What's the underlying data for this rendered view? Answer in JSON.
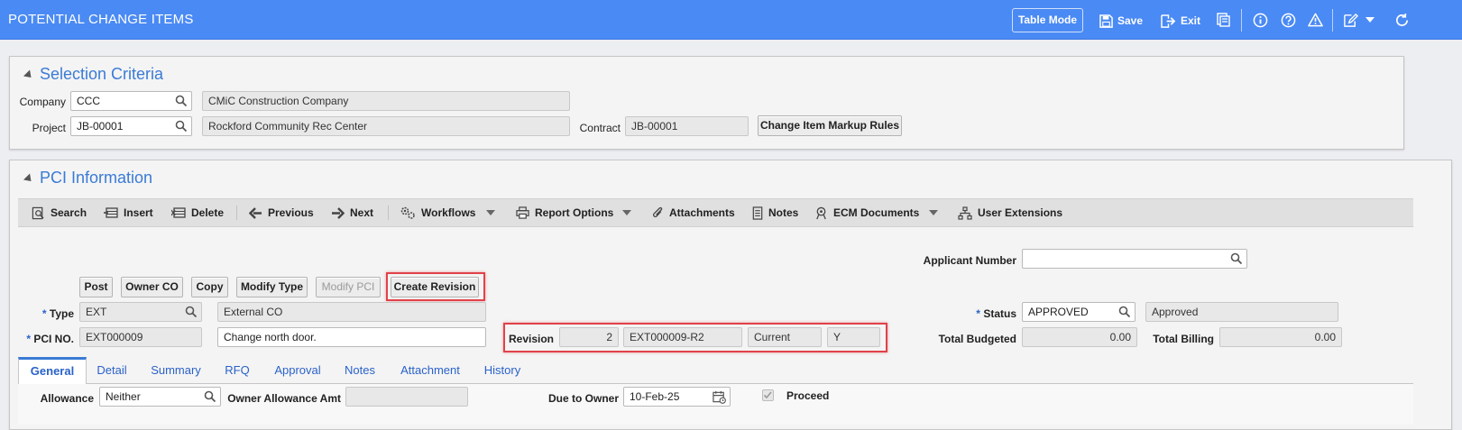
{
  "app": {
    "title": "POTENTIAL CHANGE ITEMS"
  },
  "header": {
    "table_mode": "Table Mode",
    "save": "Save",
    "exit": "Exit"
  },
  "selection": {
    "title": "Selection Criteria",
    "company_label": "Company",
    "company_code": "CCC",
    "company_name": "CMiC Construction Company",
    "project_label": "Project",
    "project_code": "JB-00001",
    "project_name": "Rockford Community Rec Center",
    "contract_label": "Contract",
    "contract_value": "JB-00001",
    "markup_button": "Change Item Markup Rules"
  },
  "pci": {
    "title": "PCI Information",
    "toolbar": {
      "search": "Search",
      "insert": "Insert",
      "delete": "Delete",
      "previous": "Previous",
      "next": "Next",
      "workflows": "Workflows",
      "report_options": "Report Options",
      "attachments": "Attachments",
      "notes": "Notes",
      "ecm_documents": "ECM Documents",
      "user_extensions": "User Extensions"
    },
    "actions": {
      "post": "Post",
      "owner_co": "Owner CO",
      "copy": "Copy",
      "modify_type": "Modify Type",
      "modify_pci": "Modify PCI",
      "create_revision": "Create Revision"
    },
    "applicant_label": "Applicant Number",
    "applicant_value": "",
    "type_label": "Type",
    "type_code": "EXT",
    "type_name": "External CO",
    "pci_no_label": "PCI NO.",
    "pci_no": "EXT000009",
    "pci_desc": "Change north door.",
    "revision_label": "Revision",
    "revision_num": "2",
    "revision_code": "EXT000009-R2",
    "revision_state": "Current",
    "revision_flag": "Y",
    "status_label": "Status",
    "status_code": "APPROVED",
    "status_name": "Approved",
    "total_budgeted_label": "Total Budgeted",
    "total_budgeted": "0.00",
    "total_billing_label": "Total Billing",
    "total_billing": "0.00",
    "required_mark": "*"
  },
  "tabs": [
    "General",
    "Detail",
    "Summary",
    "RFQ",
    "Approval",
    "Notes",
    "Attachment",
    "History"
  ],
  "general": {
    "allowance_label": "Allowance",
    "allowance_value": "Neither",
    "owner_allowance_label": "Owner Allowance Amt",
    "owner_allowance_value": "",
    "due_to_owner_label": "Due to Owner",
    "due_to_owner_value": "10-Feb-25",
    "proceed_label": "Proceed"
  },
  "colors": {
    "header_bg": "#4a8af4",
    "accent": "#3a7bd5",
    "highlight": "#e0424a"
  }
}
